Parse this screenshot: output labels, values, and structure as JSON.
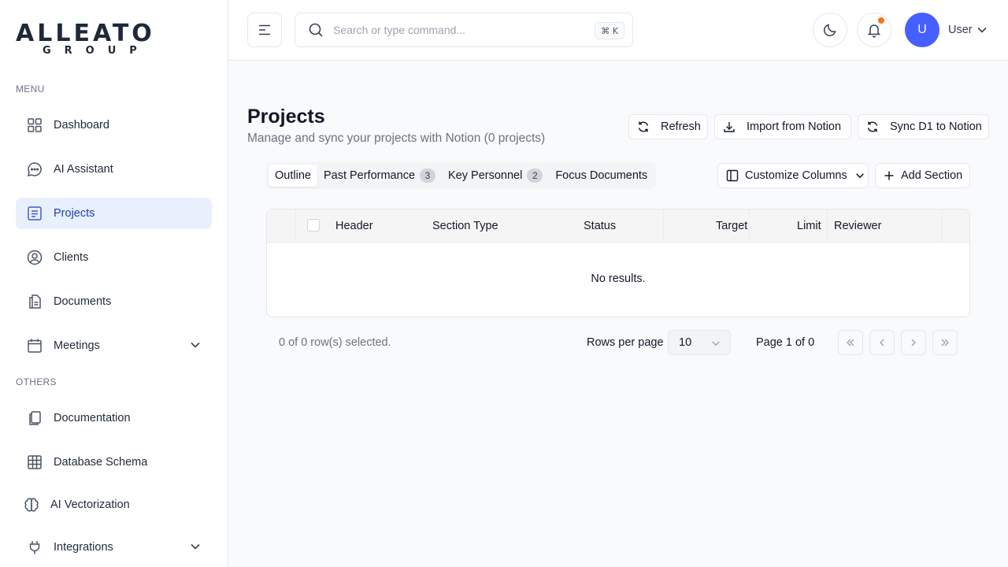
{
  "brand": {
    "logo_main": "ALLEATO",
    "logo_sub": "GROUP"
  },
  "sidebar": {
    "menu_label": "MENU",
    "others_label": "OTHERS",
    "items": [
      {
        "label": "Dashboard",
        "icon": "grid-icon"
      },
      {
        "label": "AI Assistant",
        "icon": "chat-icon"
      },
      {
        "label": "Projects",
        "icon": "list-icon",
        "active": true
      },
      {
        "label": "Clients",
        "icon": "user-circle-icon"
      },
      {
        "label": "Documents",
        "icon": "document-icon"
      },
      {
        "label": "Meetings",
        "icon": "calendar-icon",
        "expandable": true
      }
    ],
    "others": [
      {
        "label": "Documentation",
        "icon": "copy-icon"
      },
      {
        "label": "Database Schema",
        "icon": "table-icon"
      },
      {
        "label": "AI Vectorization",
        "icon": "brain-icon"
      },
      {
        "label": "Integrations",
        "icon": "plug-icon",
        "expandable": true
      }
    ]
  },
  "header": {
    "search_placeholder": "Search or type command...",
    "search_shortcut": "⌘ K",
    "user_initial": "U",
    "user_name": "User",
    "notification_dot_color": "#f97316",
    "avatar_color": "#465fff"
  },
  "main": {
    "title": "Projects",
    "subtitle": "Manage and sync your projects with Notion (0 projects)",
    "actions": {
      "refresh": "Refresh",
      "import": "Import from Notion",
      "sync": "Sync D1 to Notion"
    },
    "tabs": [
      {
        "label": "Outline",
        "active": true
      },
      {
        "label": "Past Performance",
        "count": "3"
      },
      {
        "label": "Key Personnel",
        "count": "2"
      },
      {
        "label": "Focus Documents"
      }
    ],
    "customize_columns": "Customize Columns",
    "add_section": "Add Section",
    "table": {
      "columns": [
        "Header",
        "Section Type",
        "Status",
        "Target",
        "Limit",
        "Reviewer"
      ],
      "empty_text": "No results."
    },
    "footer": {
      "selected": "0 of 0 row(s) selected.",
      "rows_per_page_label": "Rows per page",
      "rows_per_page": "10",
      "page_info": "Page 1 of 0"
    }
  }
}
